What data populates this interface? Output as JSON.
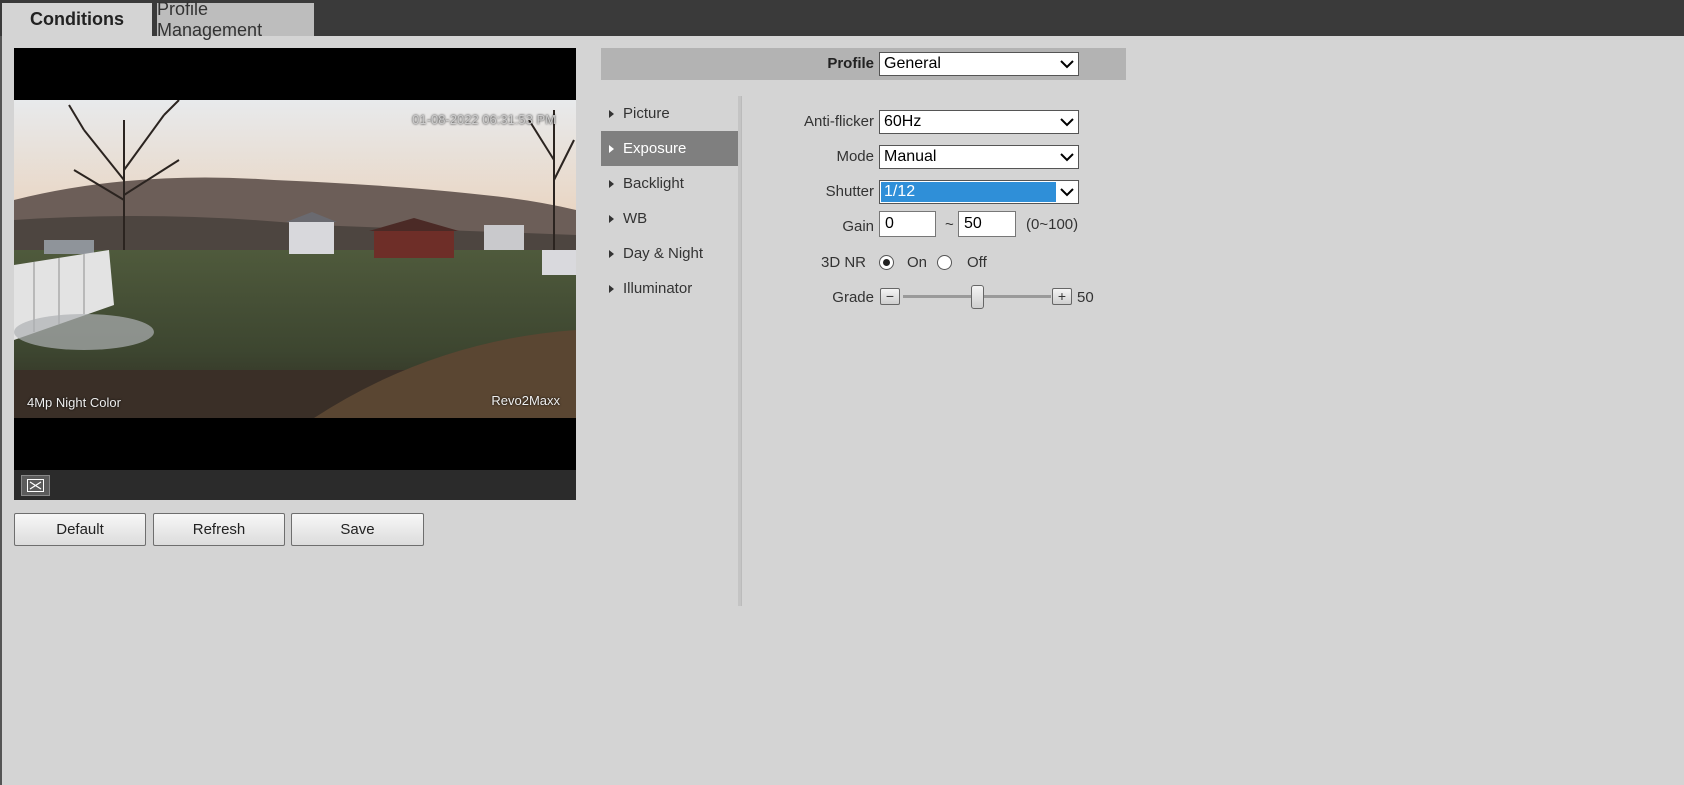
{
  "tabs": [
    {
      "label": "Conditions",
      "active": true
    },
    {
      "label": "Profile Management",
      "active": false
    }
  ],
  "video": {
    "timestamp": "01-08-2022 06:31:53 PM",
    "osd_left": "4Mp Night Color",
    "osd_right": "Revo2Maxx",
    "fullscreen_icon": "fullscreen-icon"
  },
  "buttons": {
    "default": "Default",
    "refresh": "Refresh",
    "save": "Save"
  },
  "profile": {
    "label": "Profile",
    "value": "General"
  },
  "nav": {
    "items": [
      {
        "label": "Picture",
        "active": false
      },
      {
        "label": "Exposure",
        "active": true
      },
      {
        "label": "Backlight",
        "active": false
      },
      {
        "label": "WB",
        "active": false
      },
      {
        "label": "Day & Night",
        "active": false
      },
      {
        "label": "Illuminator",
        "active": false
      }
    ]
  },
  "exposure": {
    "anti_flicker": {
      "label": "Anti-flicker",
      "value": "60Hz"
    },
    "mode": {
      "label": "Mode",
      "value": "Manual"
    },
    "shutter": {
      "label": "Shutter",
      "value": "1/12"
    },
    "gain": {
      "label": "Gain",
      "min": "0",
      "separator": "~",
      "max": "50",
      "range": "(0~100)"
    },
    "nr3d": {
      "label": "3D NR",
      "on_label": "On",
      "off_label": "Off",
      "selected": "On"
    },
    "grade": {
      "label": "Grade",
      "value": "50",
      "value_fraction": 0.5
    }
  },
  "colors": {
    "selected_highlight": "#2f8fd8",
    "nav_active": "#7f7f7f",
    "topbar": "#3a3a3a"
  }
}
